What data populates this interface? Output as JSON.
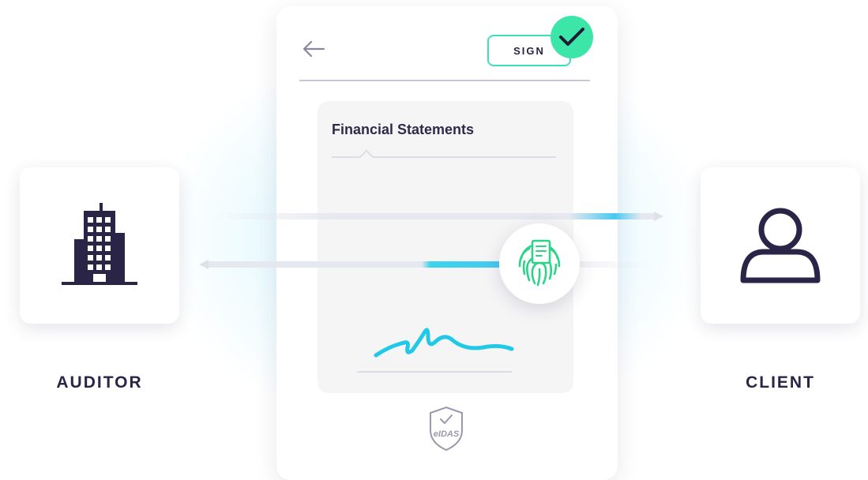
{
  "left_party": {
    "label": "AUDITOR",
    "icon": "building-icon"
  },
  "right_party": {
    "label": "CLIENT",
    "icon": "user-icon"
  },
  "phone": {
    "back_icon": "arrow-left-icon",
    "sign_label": "SIGN",
    "sign_status_icon": "checkmark-icon",
    "document": {
      "title": "Financial Statements",
      "signature_icon": "handwritten-signature"
    },
    "badge_icon": "eidas-shield-icon",
    "badge_text": "eIDAS"
  },
  "transfer": {
    "to_client_icon": "arrow-right-icon",
    "to_auditor_icon": "arrow-left-icon",
    "biometric_icon": "fingerprint-document-icon"
  },
  "colors": {
    "accent_green": "#3ce6a8",
    "accent_cyan": "#49c8f0",
    "ink": "#2a2547",
    "fingerprint": "#2ed38a"
  }
}
